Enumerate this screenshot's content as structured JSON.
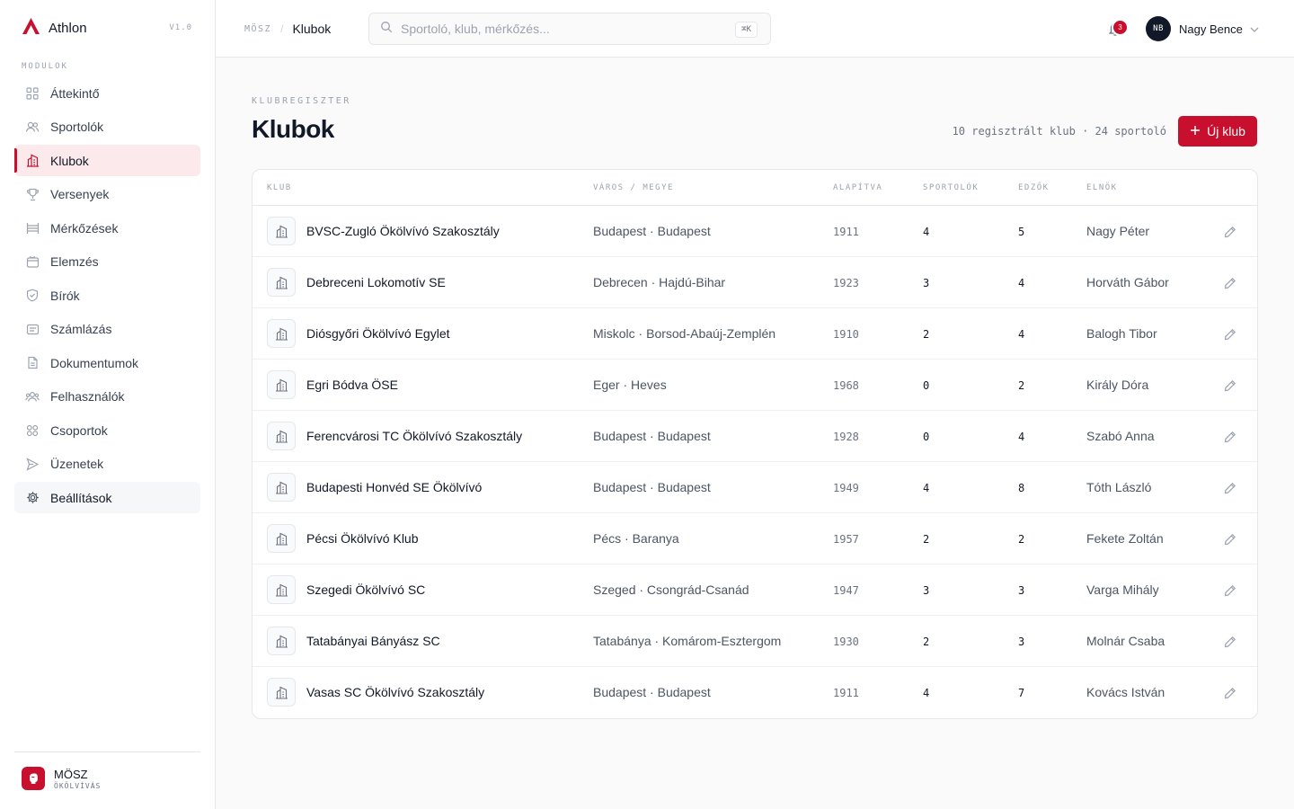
{
  "app": {
    "name": "Athlon",
    "version": "V1.0"
  },
  "sidebar": {
    "section_label": "MODULOK",
    "items": [
      {
        "label": "Áttekintő",
        "icon": "grid-icon"
      },
      {
        "label": "Sportolók",
        "icon": "users-icon"
      },
      {
        "label": "Klubok",
        "icon": "building-icon"
      },
      {
        "label": "Versenyek",
        "icon": "trophy-icon"
      },
      {
        "label": "Mérkőzések",
        "icon": "ring-icon"
      },
      {
        "label": "Elemzés",
        "icon": "analytics-icon"
      },
      {
        "label": "Bírók",
        "icon": "shield-icon"
      },
      {
        "label": "Számlázás",
        "icon": "invoice-icon"
      },
      {
        "label": "Dokumentumok",
        "icon": "document-icon"
      },
      {
        "label": "Felhasználók",
        "icon": "user-group-icon"
      },
      {
        "label": "Csoportok",
        "icon": "groups-icon"
      },
      {
        "label": "Üzenetek",
        "icon": "send-icon"
      },
      {
        "label": "Beállítások",
        "icon": "gear-icon"
      }
    ],
    "footer": {
      "org_name": "MÖSZ",
      "org_sub": "ÖKÖLVÍVÁS"
    }
  },
  "topbar": {
    "breadcrumb_root": "MÖSZ",
    "breadcrumb_sep": "/",
    "breadcrumb_current": "Klubok",
    "search_placeholder": "Sportoló, klub, mérkőzés...",
    "search_shortcut": "⌘K",
    "notification_count": "3",
    "user_initials": "NB",
    "user_name": "Nagy Bence"
  },
  "main": {
    "eyebrow": "KLUBREGISZTER",
    "title": "Klubok",
    "summary": "10 regisztrált klub · 24 sportoló",
    "new_button": "Új klub"
  },
  "table": {
    "headers": {
      "club": "KLUB",
      "city": "VÁROS / MEGYE",
      "founded": "ALAPÍTVA",
      "athletes": "SPORTOLÓK",
      "coaches": "EDZŐK",
      "president": "ELNÖK"
    },
    "rows": [
      {
        "name": "BVSC-Zugló Ökölvívó Szakosztály",
        "city": "Budapest · Budapest",
        "founded": "1911",
        "athletes": "4",
        "coaches": "5",
        "president": "Nagy Péter"
      },
      {
        "name": "Debreceni Lokomotív SE",
        "city": "Debrecen · Hajdú-Bihar",
        "founded": "1923",
        "athletes": "3",
        "coaches": "4",
        "president": "Horváth Gábor"
      },
      {
        "name": "Diósgyőri Ökölvívó Egylet",
        "city": "Miskolc · Borsod-Abaúj-Zemplén",
        "founded": "1910",
        "athletes": "2",
        "coaches": "4",
        "president": "Balogh Tibor"
      },
      {
        "name": "Egri Bódva ÖSE",
        "city": "Eger · Heves",
        "founded": "1968",
        "athletes": "0",
        "coaches": "2",
        "president": "Király Dóra"
      },
      {
        "name": "Ferencvárosi TC Ökölvívó Szakosztály",
        "city": "Budapest · Budapest",
        "founded": "1928",
        "athletes": "0",
        "coaches": "4",
        "president": "Szabó Anna"
      },
      {
        "name": "Budapesti Honvéd SE Ökölvívó",
        "city": "Budapest · Budapest",
        "founded": "1949",
        "athletes": "4",
        "coaches": "8",
        "president": "Tóth László"
      },
      {
        "name": "Pécsi Ökölvívó Klub",
        "city": "Pécs · Baranya",
        "founded": "1957",
        "athletes": "2",
        "coaches": "2",
        "president": "Fekete Zoltán"
      },
      {
        "name": "Szegedi Ökölvívó SC",
        "city": "Szeged · Csongrád-Csanád",
        "founded": "1947",
        "athletes": "3",
        "coaches": "3",
        "president": "Varga Mihály"
      },
      {
        "name": "Tatabányai Bányász SC",
        "city": "Tatabánya · Komárom-Esztergom",
        "founded": "1930",
        "athletes": "2",
        "coaches": "3",
        "president": "Molnár Csaba"
      },
      {
        "name": "Vasas SC Ökölvívó Szakosztály",
        "city": "Budapest · Budapest",
        "founded": "1911",
        "athletes": "4",
        "coaches": "7",
        "president": "Kovács István"
      }
    ]
  },
  "colors": {
    "accent": "#c8102e",
    "accent_soft": "#fbe9ec",
    "text": "#111827",
    "muted": "#6b7280",
    "border": "#e5e7eb"
  }
}
